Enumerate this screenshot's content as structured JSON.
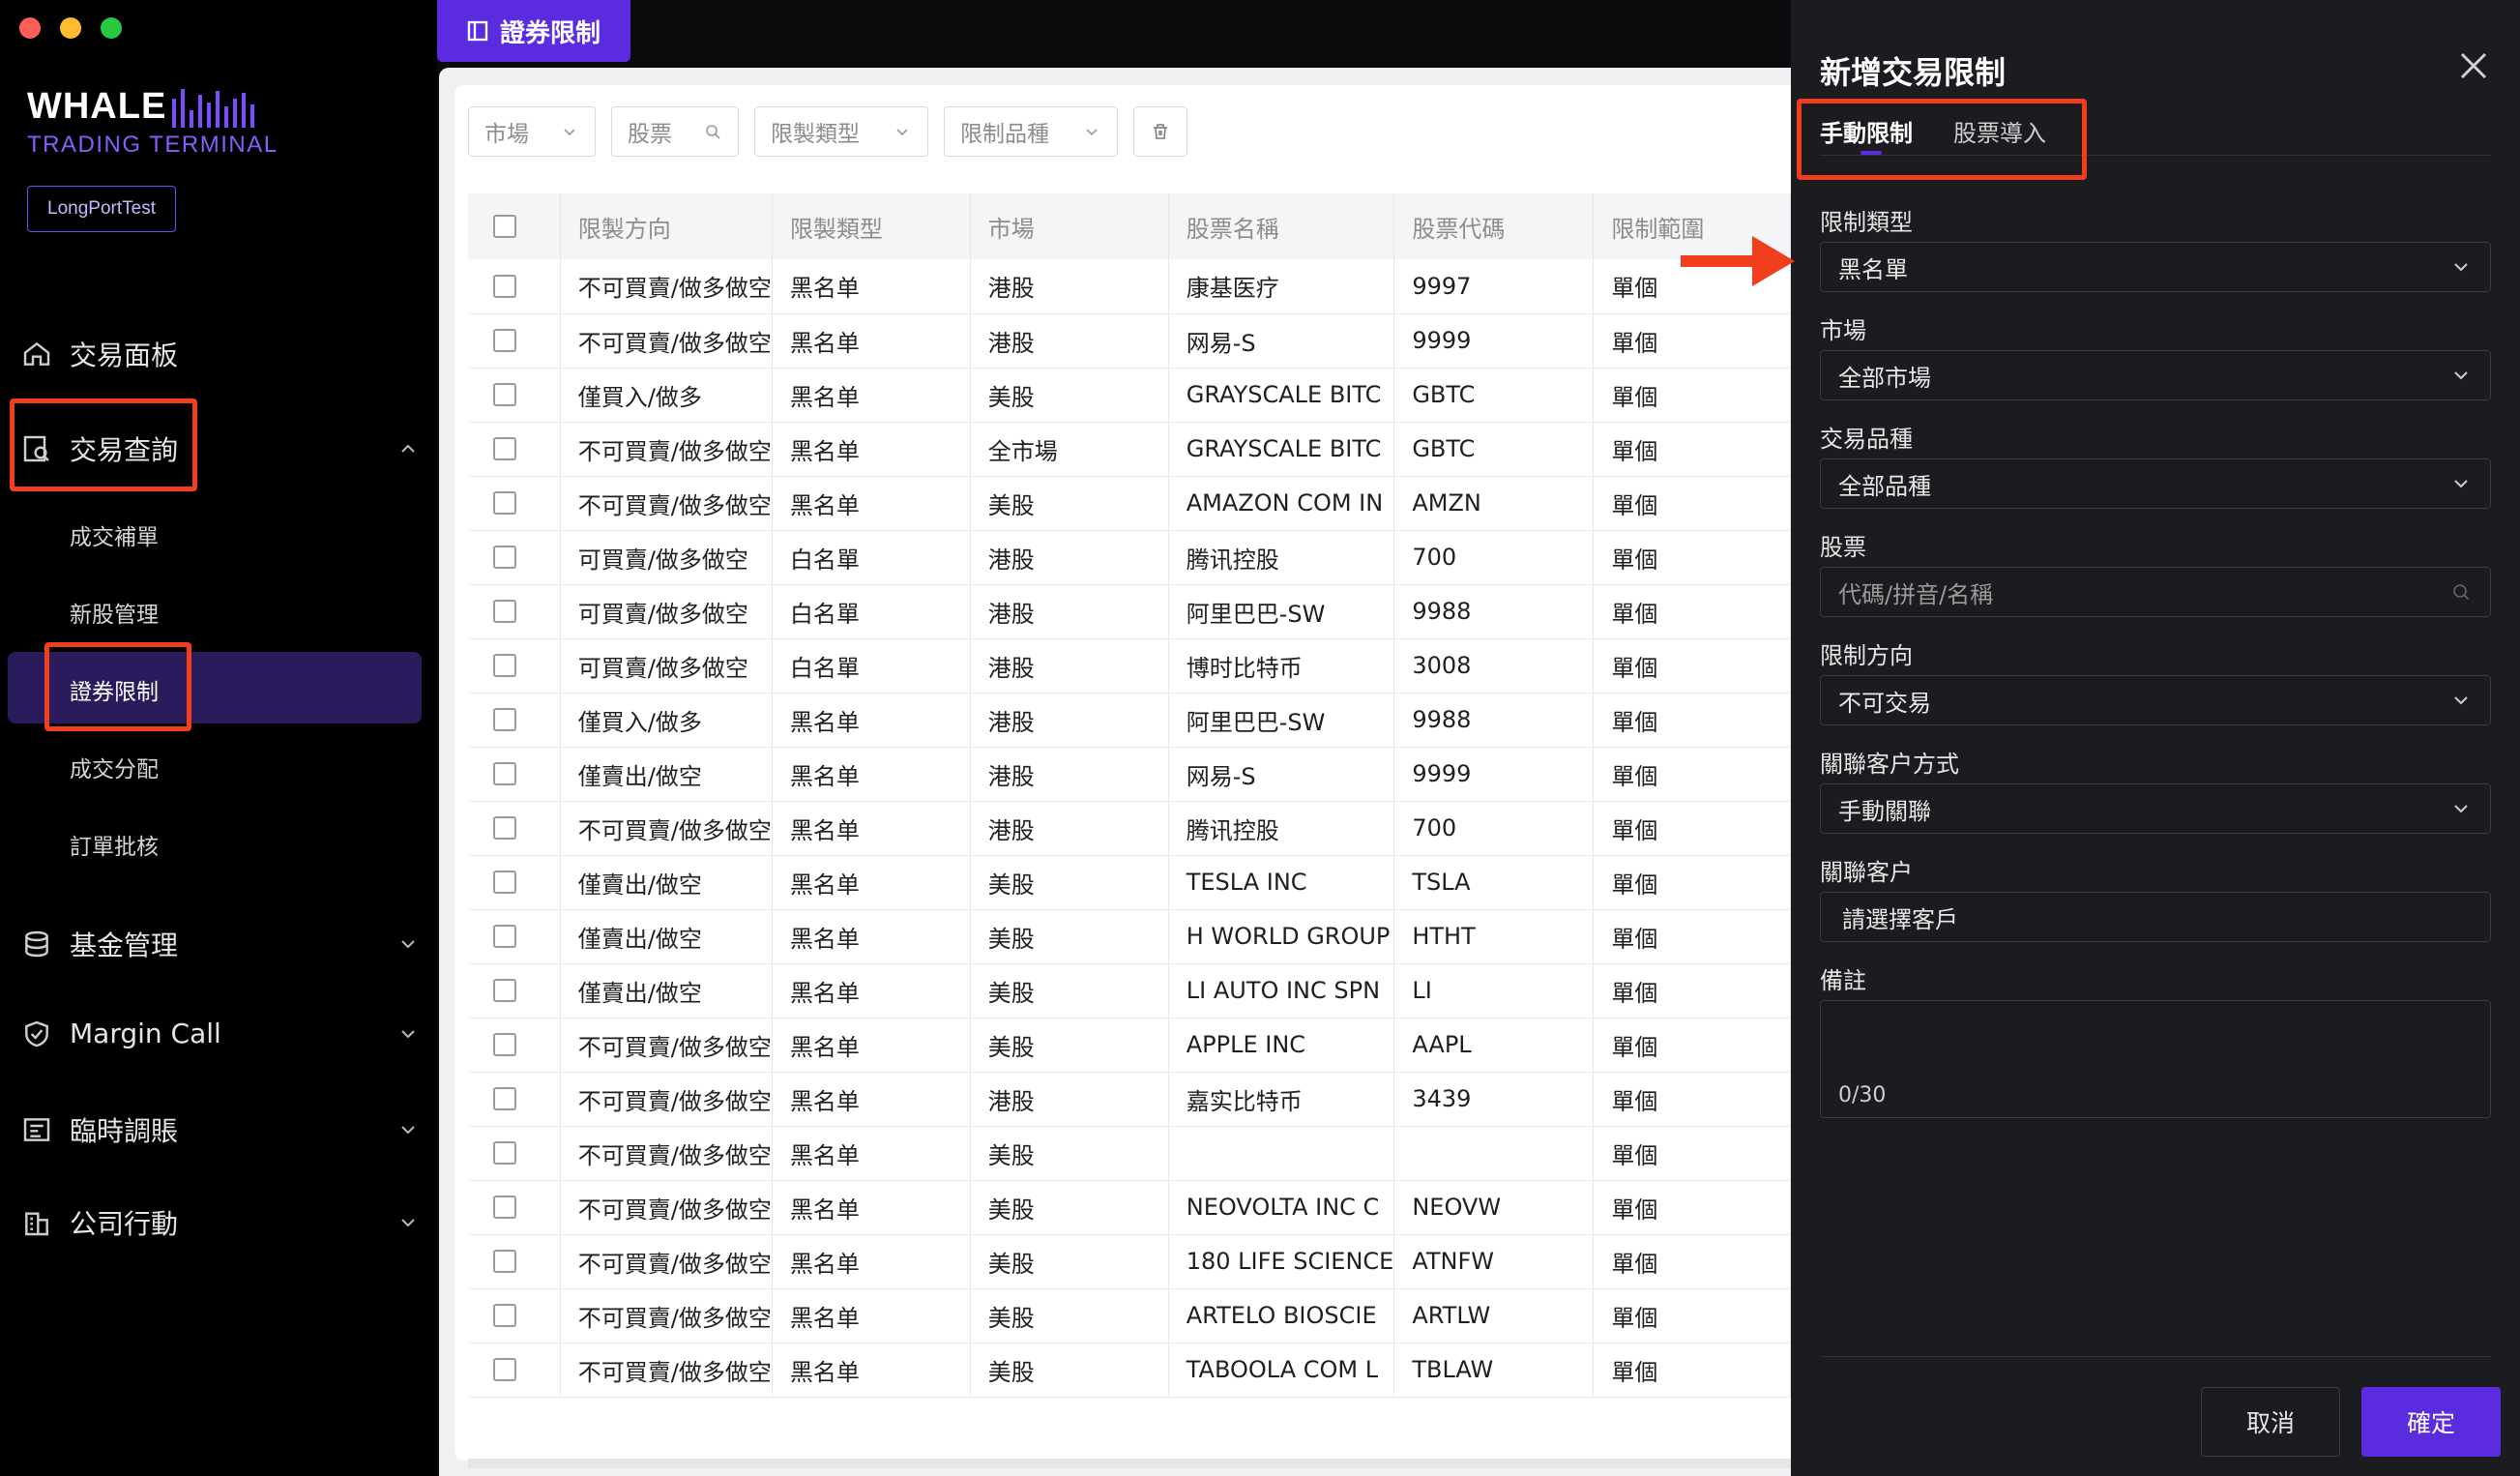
{
  "sidebar": {
    "brand": "WHALE",
    "brand_sub": "TRADING TERMINAL",
    "account": "LongPortTest",
    "nav": {
      "trading_panel": "交易面板",
      "trading_query": "交易查詢",
      "fund_mgmt": "基金管理",
      "margin_call": "Margin Call",
      "temp_adjust": "臨時調賬",
      "corp_action": "公司行動"
    },
    "sub": {
      "fill_supplement": "成交補單",
      "ipo_mgmt": "新股管理",
      "security_restriction": "證券限制",
      "fill_allocation": "成交分配",
      "order_approval": "訂單批核"
    }
  },
  "page": {
    "tab_label": "證券限制"
  },
  "filters": {
    "market": "市場",
    "stock": "股票",
    "restriction_type": "限製類型",
    "restriction_product": "限制品種"
  },
  "table": {
    "headers": [
      "限製方向",
      "限製類型",
      "市場",
      "股票名稱",
      "股票代碼",
      "限制範圍"
    ],
    "rows": [
      [
        "不可買賣/做多做空",
        "黑名单",
        "港股",
        "康基医疗",
        "9997",
        "單個"
      ],
      [
        "不可買賣/做多做空",
        "黑名单",
        "港股",
        "网易-S",
        "9999",
        "單個"
      ],
      [
        "僅買入/做多",
        "黑名单",
        "美股",
        "GRAYSCALE BITC",
        "GBTC",
        "單個"
      ],
      [
        "不可買賣/做多做空",
        "黑名单",
        "全市場",
        "GRAYSCALE BITC",
        "GBTC",
        "單個"
      ],
      [
        "不可買賣/做多做空",
        "黑名单",
        "美股",
        "AMAZON COM IN",
        "AMZN",
        "單個"
      ],
      [
        "可買賣/做多做空",
        "白名單",
        "港股",
        "腾讯控股",
        "700",
        "單個"
      ],
      [
        "可買賣/做多做空",
        "白名單",
        "港股",
        "阿里巴巴-SW",
        "9988",
        "單個"
      ],
      [
        "可買賣/做多做空",
        "白名單",
        "港股",
        "博时比特币",
        "3008",
        "單個"
      ],
      [
        "僅買入/做多",
        "黑名单",
        "港股",
        "阿里巴巴-SW",
        "9988",
        "單個"
      ],
      [
        "僅賣出/做空",
        "黑名单",
        "港股",
        "网易-S",
        "9999",
        "單個"
      ],
      [
        "不可買賣/做多做空",
        "黑名单",
        "港股",
        "腾讯控股",
        "700",
        "單個"
      ],
      [
        "僅賣出/做空",
        "黑名单",
        "美股",
        "TESLA INC",
        "TSLA",
        "單個"
      ],
      [
        "僅賣出/做空",
        "黑名单",
        "美股",
        "H WORLD GROUP",
        "HTHT",
        "單個"
      ],
      [
        "僅賣出/做空",
        "黑名单",
        "美股",
        "LI AUTO INC SPN",
        "LI",
        "單個"
      ],
      [
        "不可買賣/做多做空",
        "黑名单",
        "美股",
        "APPLE INC",
        "AAPL",
        "單個"
      ],
      [
        "不可買賣/做多做空",
        "黑名单",
        "港股",
        "嘉实比特币",
        "3439",
        "單個"
      ],
      [
        "不可買賣/做多做空",
        "黑名单",
        "美股",
        "",
        "",
        "單個"
      ],
      [
        "不可買賣/做多做空",
        "黑名单",
        "美股",
        "NEOVOLTA INC C",
        "NEOVW",
        "單個"
      ],
      [
        "不可買賣/做多做空",
        "黑名单",
        "美股",
        "180 LIFE SCIENCE",
        "ATNFW",
        "單個"
      ],
      [
        "不可買賣/做多做空",
        "黑名单",
        "美股",
        "ARTELO BIOSCIE",
        "ARTLW",
        "單個"
      ],
      [
        "不可買賣/做多做空",
        "黑名单",
        "美股",
        "TABOOLA COM L",
        "TBLAW",
        "單個"
      ]
    ]
  },
  "drawer": {
    "title": "新增交易限制",
    "tabs": [
      "手動限制",
      "股票導入"
    ],
    "fields": {
      "restriction_type_label": "限制類型",
      "restriction_type_value": "黑名單",
      "market_label": "市場",
      "market_value": "全部市場",
      "product_label": "交易品種",
      "product_value": "全部品種",
      "stock_label": "股票",
      "stock_placeholder": "代碼/拼音/名稱",
      "direction_label": "限制方向",
      "direction_value": "不可交易",
      "link_method_label": "關聯客户方式",
      "link_method_value": "手動關聯",
      "client_label": "關聯客户",
      "client_placeholder": "請選擇客戶",
      "remark_label": "備註",
      "remark_counter": "0/30"
    },
    "cancel": "取消",
    "confirm": "確定"
  },
  "colors": {
    "accent": "#5b2be0",
    "highlight": "#f13e1c"
  }
}
